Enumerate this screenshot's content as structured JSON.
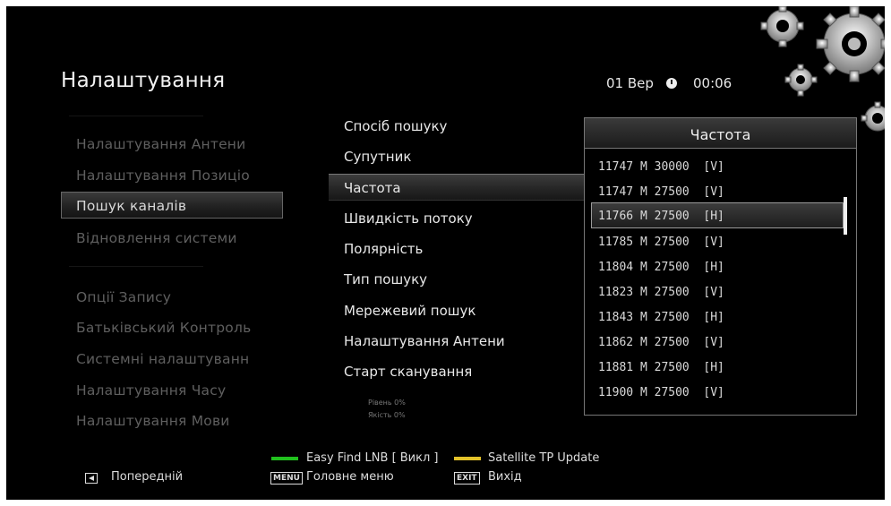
{
  "header": {
    "title": "Налаштування",
    "date": "01 Вер",
    "time": "00:06"
  },
  "left_menu": {
    "items": [
      {
        "label": "Налаштування Антени"
      },
      {
        "label": "Налаштування Позиціо"
      },
      {
        "label": "Пошук каналів",
        "selected": true
      },
      {
        "label": "Відновлення системи"
      },
      {
        "label": "Опції Запису"
      },
      {
        "label": "Батьківський Контроль"
      },
      {
        "label": "Системні налаштуванн"
      },
      {
        "label": "Налаштування Часу"
      },
      {
        "label": "Налаштування Мови"
      }
    ]
  },
  "middle_menu": {
    "items": [
      {
        "label": "Спосіб пошуку"
      },
      {
        "label": "Супутник"
      },
      {
        "label": "Частота",
        "selected": true
      },
      {
        "label": "Швидкість потоку"
      },
      {
        "label": "Полярність"
      },
      {
        "label": "Тип пошуку"
      },
      {
        "label": "Мережевий пошук"
      },
      {
        "label": "Налаштування Антени"
      },
      {
        "label": "Старт сканування"
      }
    ],
    "level": "Рівень  0%",
    "quality": "Якість  0%"
  },
  "frequency_panel": {
    "title": "Частота",
    "selected_index": 2,
    "items": [
      "11747 M 30000  [V]",
      "11747 M 27500  [V]",
      "11766 M 27500  [H]",
      "11785 M 27500  [V]",
      "11804 M 27500  [H]",
      "11823 M 27500  [V]",
      "11843 M 27500  [H]",
      "11862 M 27500  [V]",
      "11881 M 27500  [H]",
      "11900 M 27500  [V]"
    ]
  },
  "footer": {
    "green_label": "Easy Find LNB [ Викл ]",
    "yellow_label": "Satellite TP Update",
    "back_label": "Попередній",
    "menu_key": "MENU",
    "menu_label": "Головне меню",
    "exit_key": "EXIT",
    "exit_label": "Вихід"
  },
  "colors": {
    "green": "#21c01e",
    "yellow": "#e3c22a",
    "background": "#000000"
  }
}
